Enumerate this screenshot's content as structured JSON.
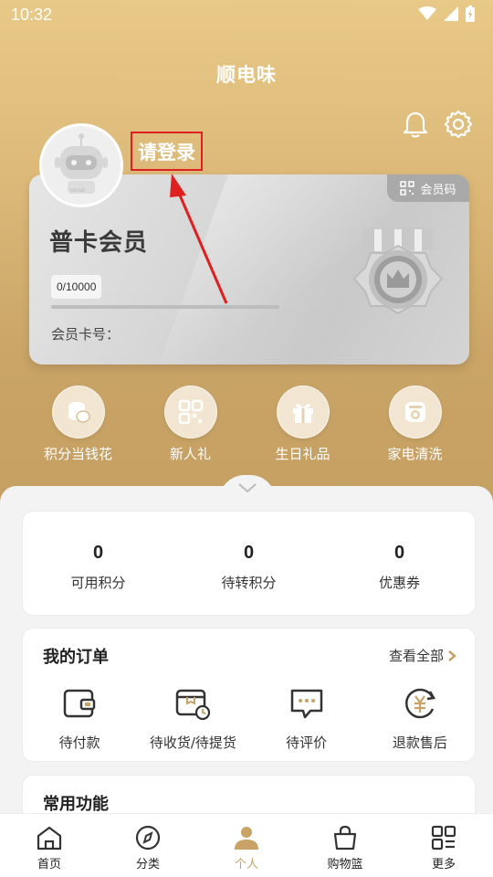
{
  "status_bar": {
    "time": "10:32"
  },
  "header": {
    "title": "顺电味"
  },
  "profile": {
    "login_text": "请登录",
    "avatar_caption": "tunlab"
  },
  "member_card": {
    "qr_label": "会员码",
    "level_title": "普卡会员",
    "points_progress_text": "0/10000",
    "progress_fraction": 0,
    "card_number_label": "会员卡号："
  },
  "quick_actions": [
    {
      "label": "积分当钱花",
      "icon": "coins-icon"
    },
    {
      "label": "新人礼",
      "icon": "qr-grid-icon"
    },
    {
      "label": "生日礼品",
      "icon": "gift-icon"
    },
    {
      "label": "家电清洗",
      "icon": "appliance-icon"
    }
  ],
  "stats": [
    {
      "value": "0",
      "label": "可用积分"
    },
    {
      "value": "0",
      "label": "待转积分"
    },
    {
      "value": "0",
      "label": "优惠券"
    }
  ],
  "orders": {
    "title": "我的订单",
    "view_all": "查看全部",
    "items": [
      {
        "label": "待付款",
        "icon": "wallet-icon"
      },
      {
        "label": "待收货/待提货",
        "icon": "package-clock-icon"
      },
      {
        "label": "待评价",
        "icon": "comment-icon"
      },
      {
        "label": "退款售后",
        "icon": "refund-yen-icon"
      }
    ]
  },
  "functions": {
    "title": "常用功能"
  },
  "tabbar": {
    "items": [
      {
        "label": "首页",
        "icon": "home-icon"
      },
      {
        "label": "分类",
        "icon": "compass-icon"
      },
      {
        "label": "个人",
        "icon": "person-icon",
        "active": true
      },
      {
        "label": "购物篮",
        "icon": "basket-icon"
      },
      {
        "label": "更多",
        "icon": "grid-more-icon"
      }
    ]
  },
  "colors": {
    "accent_gold": "#c9a266",
    "highlight_red": "#e02020"
  }
}
